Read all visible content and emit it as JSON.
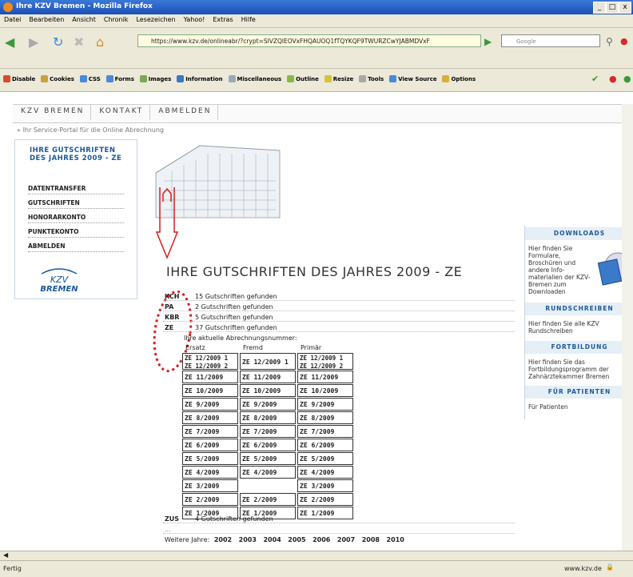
{
  "window": {
    "title": "Ihre KZV Bremen - Mozilla Firefox",
    "controls": [
      "_",
      "□",
      "x"
    ]
  },
  "menu": [
    "Datei",
    "Bearbeiten",
    "Ansicht",
    "Chronik",
    "Lesezeichen",
    "Yahoo!",
    "Extras",
    "Hilfe"
  ],
  "navbar": {
    "url": "https://www.kzv.de/onlineabr/?crypt=SlVZQlEOVxFHQAUOQ1fTQYKQF9TWURZCwYJABMDVxF",
    "search_placeholder": "Google"
  },
  "toolbar2": [
    {
      "label": "Disable",
      "color": "#d84a2a"
    },
    {
      "label": "Cookies",
      "color": "#c9a23a"
    },
    {
      "label": "CSS",
      "color": "#4a8ad8"
    },
    {
      "label": "Forms",
      "color": "#4a8ad8"
    },
    {
      "label": "Images",
      "color": "#7aa858"
    },
    {
      "label": "Information",
      "color": "#3a78c8"
    },
    {
      "label": "Miscellaneous",
      "color": "#9ab"
    },
    {
      "label": "Outline",
      "color": "#8ab848"
    },
    {
      "label": "Resize",
      "color": "#d8c038"
    },
    {
      "label": "Tools",
      "color": "#a8a8a8"
    },
    {
      "label": "View Source",
      "color": "#4a8ad8"
    },
    {
      "label": "Options",
      "color": "#d8b038"
    }
  ],
  "topnav": [
    "KZV BREMEN",
    "KONTAKT",
    "ABMELDEN"
  ],
  "breadcrumb": "Ihr Service-Portal für die Online Abrechnung",
  "sidebar": {
    "title": "IHRE GUTSCHRIFTEN DES JAHRES 2009 - ZE",
    "items": [
      "DATENTRANSFER",
      "GUTSCHRIFTEN",
      "HONORARKONTO",
      "PUNKTEKONTO",
      "ABMELDEN"
    ],
    "logo_text": "KZV",
    "logo_sub": "BREMEN"
  },
  "heading": "IHRE GUTSCHRIFTEN DES JAHRES 2009 - ZE",
  "counts": [
    {
      "code": "KCH",
      "text": "15 Gutschriften gefunden"
    },
    {
      "code": "PA",
      "text": "2 Gutschriften gefunden"
    },
    {
      "code": "KBR",
      "text": "5 Gutschriften gefunden"
    },
    {
      "code": "ZE",
      "text": "37 Gutschriften gefunden"
    }
  ],
  "abrechnungsnummer_label": "Ihre aktuelle Abrechnungsnummer:",
  "columns": [
    "Ersatz",
    "Fremd",
    "Primär"
  ],
  "rows": [
    [
      "ZE 12/2009 1|ZE 12/2009 2",
      "ZE 12/2009 1",
      "ZE 12/2009 1|ZE 12/2009 2"
    ],
    [
      "ZE 11/2009",
      "ZE 11/2009",
      "ZE 11/2009"
    ],
    [
      "ZE 10/2009",
      "ZE 10/2009",
      "ZE 10/2009"
    ],
    [
      "ZE 9/2009",
      "ZE 9/2009",
      "ZE 9/2009"
    ],
    [
      "ZE 8/2009",
      "ZE 8/2009",
      "ZE 8/2009"
    ],
    [
      "ZE 7/2009",
      "ZE 7/2009",
      "ZE 7/2009"
    ],
    [
      "ZE 6/2009",
      "ZE 6/2009",
      "ZE 6/2009"
    ],
    [
      "ZE 5/2009",
      "ZE 5/2009",
      "ZE 5/2009"
    ],
    [
      "ZE 4/2009",
      "ZE 4/2009",
      "ZE 4/2009"
    ],
    [
      "ZE 3/2009",
      "",
      "ZE 3/2009"
    ],
    [
      "ZE 2/2009",
      "ZE 2/2009",
      "ZE 2/2009"
    ],
    [
      "ZE 1/2009",
      "ZE 1/2009",
      "ZE 1/2009"
    ]
  ],
  "zus": {
    "code": "ZUS",
    "text": "4 Gutschriften gefunden"
  },
  "ellipsis": "...",
  "weitere": {
    "label": "Weitere Jahre:",
    "years": [
      "2002",
      "2003",
      "2004",
      "2005",
      "2006",
      "2007",
      "2008",
      "2010"
    ]
  },
  "rightbar": [
    {
      "head": "DOWNLOADS",
      "text": "Hier finden Sie Formulare, Broschüren und andere Info-materialien der KZV-Bremen zum Downloaden"
    },
    {
      "head": "RUNDSCHREIBEN",
      "text": "Hier finden Sie alle KZV Rundschreiben"
    },
    {
      "head": "FORTBILDUNG",
      "text": "Hier finden Sie das Fortbildungsprogramm der Zahnärztekammer Bremen"
    },
    {
      "head": "FÜR PATIENTEN",
      "text": "Für Patienten"
    }
  ],
  "status": {
    "left": "Fertig",
    "right": "www.kzv.de"
  },
  "accent_color": "#1a5a9a",
  "annotation_color": "#d81e1e"
}
